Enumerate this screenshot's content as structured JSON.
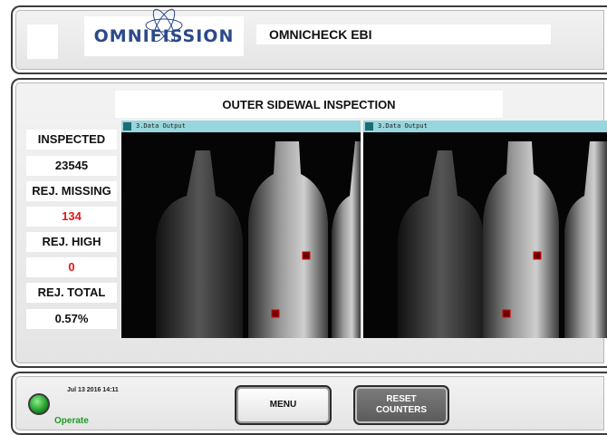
{
  "header": {
    "logo_text": "OMNIFISSION",
    "system_name": "OMNICHECK EBI"
  },
  "main": {
    "section_title": "OUTER SIDEWAL INSPECTION",
    "stats": [
      {
        "label": "INSPECTED",
        "value": "23545"
      },
      {
        "label": "REJ. MISSING",
        "value": "134"
      },
      {
        "label": "REJ. HIGH",
        "value": "0"
      },
      {
        "label": "REJ. TOTAL",
        "value": "0.57%"
      }
    ],
    "cameras": [
      {
        "title": "3.Data Output"
      },
      {
        "title": "3.Data Output"
      }
    ]
  },
  "footer": {
    "datetime": "Jul 13 2016 14:11",
    "status": "Operate",
    "menu_label": "MENU",
    "reset_label": "RESET\nCOUNTERS"
  },
  "colors": {
    "reject_red": "#e01818",
    "status_green": "#1f9a2a",
    "camera_bar": "#97d6dd",
    "logo_blue": "#2b4a8a"
  }
}
